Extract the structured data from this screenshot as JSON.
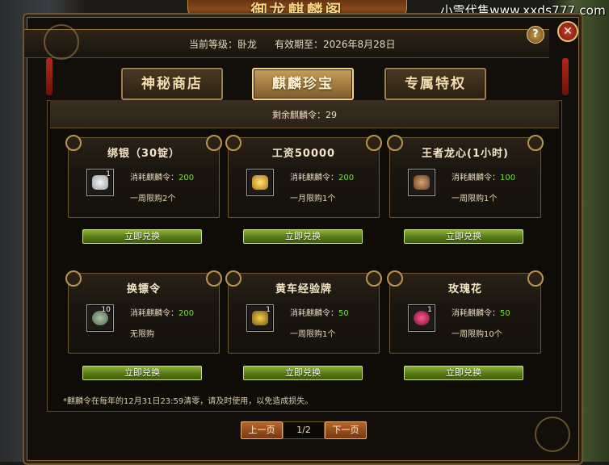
{
  "window": {
    "title": "御龙麒麟阁",
    "watermark": "小雪代售www.xxds777.com"
  },
  "header": {
    "level_label": "当前等级：卧龙",
    "expiry_label": "有效期至：2026年8月28日",
    "help_label": "?",
    "close_label": "✕"
  },
  "tabs": [
    {
      "label": "神秘商店",
      "active": false
    },
    {
      "label": "麒麟珍宝",
      "active": true
    },
    {
      "label": "专属特权",
      "active": false
    }
  ],
  "remaining": "剩余麒麟令：29",
  "items": [
    {
      "name": "绑银（30锭）",
      "qty": "1",
      "cost_label": "消耗麒麟令：",
      "cost": "200",
      "limit": "一周限购2个",
      "button": "立即兑换",
      "icon": "silver-ingot-icon"
    },
    {
      "name": "工资50000",
      "qty": "",
      "cost_label": "消耗麒麟令：",
      "cost": "200",
      "limit": "一月限购1个",
      "button": "立即兑换",
      "icon": "gold-pot-icon"
    },
    {
      "name": "王者龙心(1小时)",
      "qty": "",
      "cost_label": "消耗麒麟令：",
      "cost": "100",
      "limit": "一周限购1个",
      "button": "立即兑换",
      "icon": "dragon-heart-icon"
    },
    {
      "name": "换镖令",
      "qty": "10",
      "cost_label": "消耗麒麟令：",
      "cost": "200",
      "limit": "无限购",
      "button": "立即兑换",
      "icon": "escort-token-icon"
    },
    {
      "name": "黄车经验牌",
      "qty": "1",
      "cost_label": "消耗麒麟令：",
      "cost": "50",
      "limit": "一周限购1个",
      "button": "立即兑换",
      "icon": "yellow-cart-icon"
    },
    {
      "name": "玫瑰花",
      "qty": "1",
      "cost_label": "消耗麒麟令：",
      "cost": "50",
      "limit": "一周限购10个",
      "button": "立即兑换",
      "icon": "rose-icon"
    }
  ],
  "note": "*麒麟令在每年的12月31日23:59清零，请及时使用，以免造成损失。",
  "pager": {
    "prev": "上一页",
    "page": "1/2",
    "next": "下一页"
  }
}
